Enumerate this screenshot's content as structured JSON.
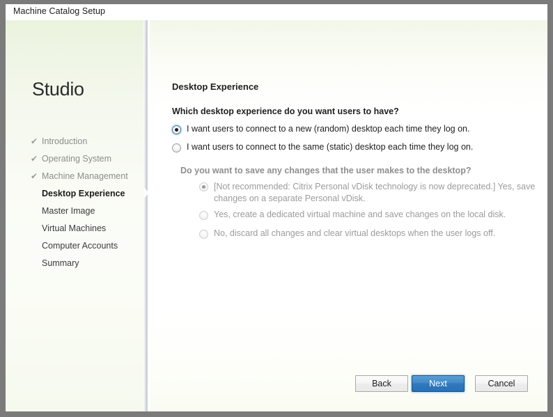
{
  "window": {
    "title": "Machine Catalog Setup"
  },
  "sidebar": {
    "logo": "Studio",
    "steps": [
      {
        "label": "Introduction",
        "state": "done",
        "icon": "check-icon"
      },
      {
        "label": "Operating System",
        "state": "done",
        "icon": "check-icon"
      },
      {
        "label": "Machine Management",
        "state": "done",
        "icon": "check-icon"
      },
      {
        "label": "Desktop Experience",
        "state": "current",
        "icon": ""
      },
      {
        "label": "Master Image",
        "state": "pending",
        "icon": ""
      },
      {
        "label": "Virtual Machines",
        "state": "pending",
        "icon": ""
      },
      {
        "label": "Computer Accounts",
        "state": "pending",
        "icon": ""
      },
      {
        "label": "Summary",
        "state": "pending",
        "icon": ""
      }
    ],
    "check_glyph": "✔"
  },
  "content": {
    "page_title": "Desktop Experience",
    "main_question": "Which desktop experience do you want users to have?",
    "options": [
      {
        "label": "I want users to connect to a new (random) desktop each time they log on.",
        "checked": true,
        "disabled": false
      },
      {
        "label": "I want users to connect to the same (static) desktop each time they log on.",
        "checked": false,
        "disabled": false
      }
    ],
    "sub_question": "Do you want to save any changes that the user makes to the desktop?",
    "sub_options": [
      {
        "label": "[Not recommended: Citrix Personal vDisk technology is now deprecated.] Yes, save changes on a separate Personal vDisk.",
        "checked": true,
        "disabled": true
      },
      {
        "label": "Yes, create a dedicated virtual machine and save changes on the local disk.",
        "checked": false,
        "disabled": true
      },
      {
        "label": "No, discard all changes and clear virtual desktops when the user logs off.",
        "checked": false,
        "disabled": true
      }
    ]
  },
  "footer": {
    "back_label": "Back",
    "next_label": "Next",
    "cancel_label": "Cancel"
  },
  "colors": {
    "accent_blue": "#2f79bd",
    "radio_focus_ring": "#3c7fb1",
    "nav_tint": "#eaf3dd",
    "frame_gray": "#7b7b7b",
    "disabled_text": "#9b9b9b"
  }
}
